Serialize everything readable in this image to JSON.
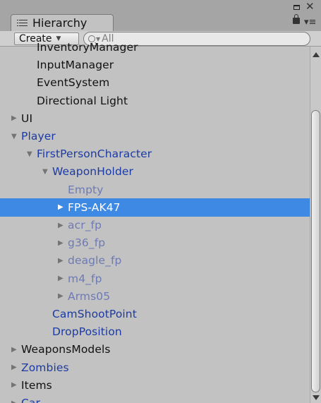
{
  "tab": {
    "title": "Hierarchy"
  },
  "toolbar": {
    "create_label": "Create",
    "search_placeholder": "All"
  },
  "tree": [
    {
      "label": "InventoryManager",
      "depth": 1,
      "arrow": "",
      "style": "normal"
    },
    {
      "label": "InputManager",
      "depth": 1,
      "arrow": "",
      "style": "normal"
    },
    {
      "label": "EventSystem",
      "depth": 1,
      "arrow": "",
      "style": "normal"
    },
    {
      "label": "Directional Light",
      "depth": 1,
      "arrow": "",
      "style": "normal"
    },
    {
      "label": "UI",
      "depth": 0,
      "arrow": "▶",
      "style": "normal"
    },
    {
      "label": "Player",
      "depth": 0,
      "arrow": "▼",
      "style": "prefab"
    },
    {
      "label": "FirstPersonCharacter",
      "depth": 1,
      "arrow": "▼",
      "style": "prefab"
    },
    {
      "label": "WeaponHolder",
      "depth": 2,
      "arrow": "▼",
      "style": "prefab"
    },
    {
      "label": "Empty",
      "depth": 3,
      "arrow": "",
      "style": "disabled"
    },
    {
      "label": "FPS-AK47",
      "depth": 3,
      "arrow": "▶",
      "style": "selected"
    },
    {
      "label": "acr_fp",
      "depth": 3,
      "arrow": "▶",
      "style": "disabled"
    },
    {
      "label": "g36_fp",
      "depth": 3,
      "arrow": "▶",
      "style": "disabled"
    },
    {
      "label": "deagle_fp",
      "depth": 3,
      "arrow": "▶",
      "style": "disabled"
    },
    {
      "label": "m4_fp",
      "depth": 3,
      "arrow": "▶",
      "style": "disabled"
    },
    {
      "label": "Arms05",
      "depth": 3,
      "arrow": "▶",
      "style": "disabled"
    },
    {
      "label": "CamShootPoint",
      "depth": 2,
      "arrow": "",
      "style": "prefab"
    },
    {
      "label": "DropPosition",
      "depth": 2,
      "arrow": "",
      "style": "prefab"
    },
    {
      "label": "WeaponsModels",
      "depth": 0,
      "arrow": "▶",
      "style": "normal"
    },
    {
      "label": "Zombies",
      "depth": 0,
      "arrow": "▶",
      "style": "prefab"
    },
    {
      "label": "Items",
      "depth": 0,
      "arrow": "▶",
      "style": "normal"
    },
    {
      "label": "Car",
      "depth": 0,
      "arrow": "▶",
      "style": "prefab"
    }
  ]
}
